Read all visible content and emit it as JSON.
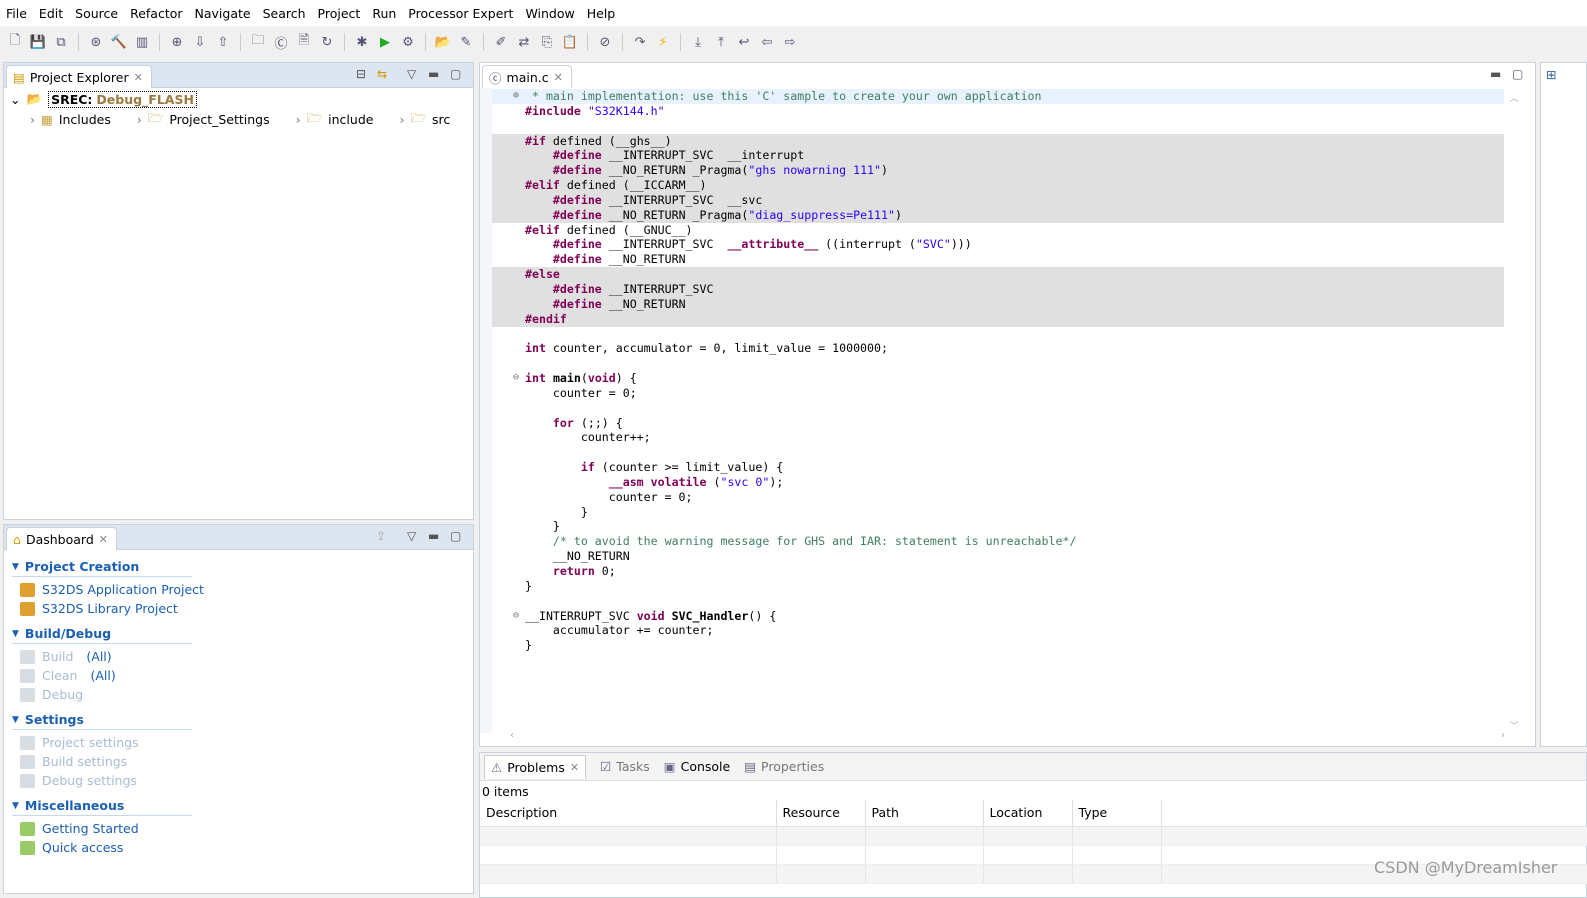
{
  "menu": [
    "File",
    "Edit",
    "Source",
    "Refactor",
    "Navigate",
    "Search",
    "Project",
    "Run",
    "Processor Expert",
    "Window",
    "Help"
  ],
  "explorer": {
    "title": "Project Explorer",
    "root_name": "SREC:",
    "root_config": "Debug_FLASH",
    "items": [
      "Includes",
      "Project_Settings",
      "include",
      "src"
    ]
  },
  "dashboard": {
    "title": "Dashboard",
    "sections": [
      {
        "title": "Project Creation",
        "items": [
          {
            "label": "S32DS Application Project",
            "extra": "",
            "enabled": true
          },
          {
            "label": "S32DS Library Project",
            "extra": "",
            "enabled": true
          }
        ]
      },
      {
        "title": "Build/Debug",
        "items": [
          {
            "label": "Build",
            "extra": "(All)",
            "enabled": false
          },
          {
            "label": "Clean",
            "extra": "(All)",
            "enabled": false
          },
          {
            "label": "Debug",
            "extra": "",
            "enabled": false
          }
        ]
      },
      {
        "title": "Settings",
        "items": [
          {
            "label": "Project settings",
            "extra": "",
            "enabled": false
          },
          {
            "label": "Build settings",
            "extra": "",
            "enabled": false
          },
          {
            "label": "Debug settings",
            "extra": "",
            "enabled": false
          }
        ]
      },
      {
        "title": "Miscellaneous",
        "items": [
          {
            "label": "Getting Started",
            "extra": "",
            "enabled": true
          },
          {
            "label": "Quick access",
            "extra": "",
            "enabled": true
          }
        ]
      }
    ]
  },
  "editor": {
    "tab": "main.c",
    "lines": [
      {
        "t": [
          [
            "cm",
            " * main implementation: use this 'C' sample to create your own application"
          ]
        ],
        "cur": true,
        "fold": "+"
      },
      {
        "t": [
          [
            "kw",
            "#include"
          ],
          [
            "p",
            " "
          ],
          [
            "str",
            "\"S32K144.h\""
          ]
        ]
      },
      {
        "t": []
      },
      {
        "t": [
          [
            "kw",
            "#if"
          ],
          [
            "p",
            " defined (__ghs__)"
          ]
        ],
        "hl": true
      },
      {
        "t": [
          [
            "p",
            "    "
          ],
          [
            "kw",
            "#define"
          ],
          [
            "p",
            " __INTERRUPT_SVC  __interrupt"
          ]
        ],
        "hl": true
      },
      {
        "t": [
          [
            "p",
            "    "
          ],
          [
            "kw",
            "#define"
          ],
          [
            "p",
            " __NO_RETURN _Pragma("
          ],
          [
            "str",
            "\"ghs nowarning 111\""
          ],
          [
            "p",
            ")"
          ]
        ],
        "hl": true
      },
      {
        "t": [
          [
            "kw",
            "#elif"
          ],
          [
            "p",
            " defined (__ICCARM__)"
          ]
        ],
        "hl": true
      },
      {
        "t": [
          [
            "p",
            "    "
          ],
          [
            "kw",
            "#define"
          ],
          [
            "p",
            " __INTERRUPT_SVC  __svc"
          ]
        ],
        "hl": true
      },
      {
        "t": [
          [
            "p",
            "    "
          ],
          [
            "kw",
            "#define"
          ],
          [
            "p",
            " __NO_RETURN _Pragma("
          ],
          [
            "str",
            "\"diag_suppress=Pe111\""
          ],
          [
            "p",
            ")"
          ]
        ],
        "hl": true
      },
      {
        "t": [
          [
            "kw",
            "#elif"
          ],
          [
            "p",
            " defined (__GNUC__)"
          ]
        ]
      },
      {
        "t": [
          [
            "p",
            "    "
          ],
          [
            "kw",
            "#define"
          ],
          [
            "p",
            " __INTERRUPT_SVC  "
          ],
          [
            "kw",
            "__attribute__"
          ],
          [
            "p",
            " ((interrupt ("
          ],
          [
            "str",
            "\"SVC\""
          ],
          [
            "p",
            ")))"
          ]
        ]
      },
      {
        "t": [
          [
            "p",
            "    "
          ],
          [
            "kw",
            "#define"
          ],
          [
            "p",
            " __NO_RETURN"
          ]
        ]
      },
      {
        "t": [
          [
            "kw",
            "#else"
          ]
        ],
        "hl": true
      },
      {
        "t": [
          [
            "p",
            "    "
          ],
          [
            "kw",
            "#define"
          ],
          [
            "p",
            " __INTERRUPT_SVC"
          ]
        ],
        "hl": true
      },
      {
        "t": [
          [
            "p",
            "    "
          ],
          [
            "kw",
            "#define"
          ],
          [
            "p",
            " __NO_RETURN"
          ]
        ],
        "hl": true
      },
      {
        "t": [
          [
            "kw",
            "#endif"
          ]
        ],
        "hl": true
      },
      {
        "t": []
      },
      {
        "t": [
          [
            "kw",
            "int"
          ],
          [
            "p",
            " counter, accumulator = 0, limit_value = 1000000;"
          ]
        ]
      },
      {
        "t": []
      },
      {
        "t": [
          [
            "kw",
            "int"
          ],
          [
            "p",
            " "
          ],
          [
            "fn",
            "main"
          ],
          [
            "p",
            "("
          ],
          [
            "kw",
            "void"
          ],
          [
            "p",
            ") {"
          ]
        ],
        "fold": "-"
      },
      {
        "t": [
          [
            "p",
            "    counter = 0;"
          ]
        ]
      },
      {
        "t": []
      },
      {
        "t": [
          [
            "p",
            "    "
          ],
          [
            "kw",
            "for"
          ],
          [
            "p",
            " (;;) {"
          ]
        ]
      },
      {
        "t": [
          [
            "p",
            "        counter++;"
          ]
        ]
      },
      {
        "t": []
      },
      {
        "t": [
          [
            "p",
            "        "
          ],
          [
            "kw",
            "if"
          ],
          [
            "p",
            " (counter >= limit_value) {"
          ]
        ]
      },
      {
        "t": [
          [
            "p",
            "            "
          ],
          [
            "kw",
            "__asm volatile"
          ],
          [
            "p",
            " ("
          ],
          [
            "str",
            "\"svc 0\""
          ],
          [
            "p",
            ");"
          ]
        ]
      },
      {
        "t": [
          [
            "p",
            "            counter = 0;"
          ]
        ]
      },
      {
        "t": [
          [
            "p",
            "        }"
          ]
        ]
      },
      {
        "t": [
          [
            "p",
            "    }"
          ]
        ]
      },
      {
        "t": [
          [
            "p",
            "    "
          ],
          [
            "cm",
            "/* to avoid the warning message for GHS and IAR: statement is unreachable*/"
          ]
        ]
      },
      {
        "t": [
          [
            "p",
            "    __NO_RETURN"
          ]
        ]
      },
      {
        "t": [
          [
            "p",
            "    "
          ],
          [
            "kw",
            "return"
          ],
          [
            "p",
            " 0;"
          ]
        ]
      },
      {
        "t": [
          [
            "p",
            "}"
          ]
        ]
      },
      {
        "t": []
      },
      {
        "t": [
          [
            "p",
            "__INTERRUPT_SVC "
          ],
          [
            "kw",
            "void"
          ],
          [
            "p",
            " "
          ],
          [
            "fn",
            "SVC_Handler"
          ],
          [
            "p",
            "() {"
          ]
        ],
        "fold": "-"
      },
      {
        "t": [
          [
            "p",
            "    accumulator += counter;"
          ]
        ]
      },
      {
        "t": [
          [
            "p",
            "}"
          ]
        ]
      }
    ]
  },
  "bottom": {
    "tabs": [
      "Problems",
      "Tasks",
      "Console",
      "Properties"
    ],
    "status": "0 items",
    "columns": [
      "Description",
      "Resource",
      "Path",
      "Location",
      "Type"
    ]
  },
  "watermark": "CSDN @MyDreamIsher"
}
